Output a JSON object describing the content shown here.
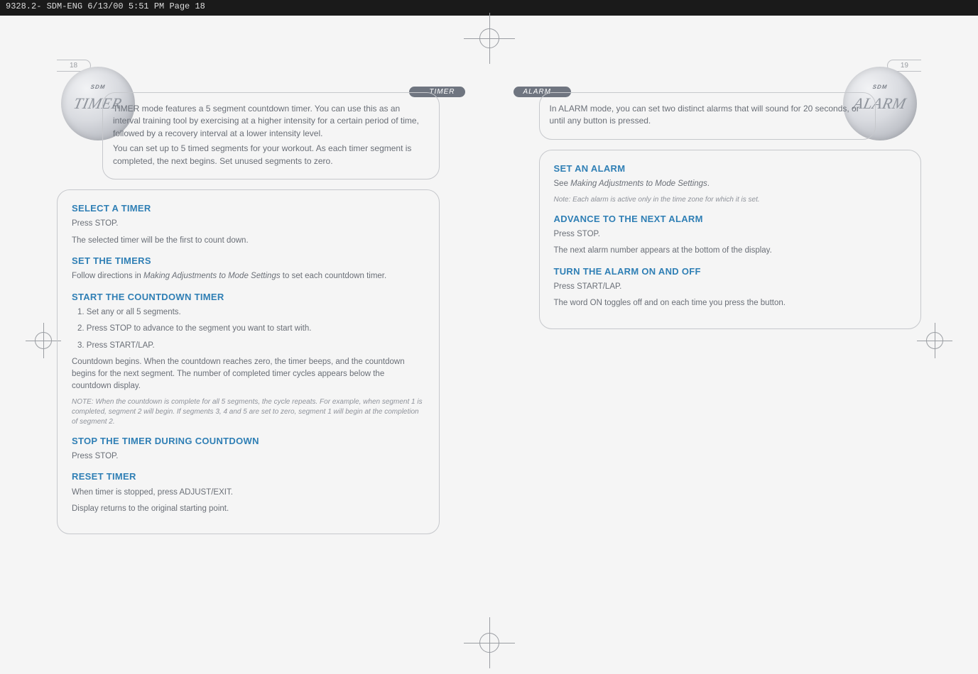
{
  "header": {
    "filename": "9328.2- SDM-ENG  6/13/00  5:51 PM  Page 18"
  },
  "left": {
    "page_number": "18",
    "mode_tab": "TIMER",
    "watch_label": "TIMER",
    "watch_brand": "SDM",
    "intro_p1": "TIMER mode features a 5 segment countdown timer. You can use this as an interval training tool by exercising at a higher intensity for a certain period of time, followed by a recovery interval at a lower intensity level.",
    "intro_p2": "You can set up to 5 timed segments for your workout. As each timer segment is completed, the next begins. Set unused segments to zero.",
    "sec1": {
      "title": "SELECT A TIMER",
      "p1": "Press STOP.",
      "p2": "The selected timer will be the first to count down."
    },
    "sec2": {
      "title": "SET THE TIMERS",
      "p1_a": "Follow directions in ",
      "p1_em": "Making Adjustments to Mode Settings",
      "p1_b": " to set each countdown timer."
    },
    "sec3": {
      "title": "START THE COUNTDOWN TIMER",
      "step1": "1. Set any or all 5 segments.",
      "step2": "2. Press STOP to advance to the segment you want to start with.",
      "step3": "3. Press START/LAP.",
      "p1": "Countdown begins. When the countdown reaches zero, the timer beeps, and the countdown begins for the next segment. The number of completed timer cycles appears below the countdown display.",
      "note": "NOTE: When the countdown is complete for all 5 segments, the cycle repeats. For example, when segment 1 is completed, segment 2 will begin. If segments 3, 4 and 5 are set to zero, segment 1 will begin at the completion of segment 2."
    },
    "sec4": {
      "title": "STOP THE TIMER DURING COUNTDOWN",
      "p1": "Press STOP."
    },
    "sec5": {
      "title": "RESET TIMER",
      "p1": "When timer is stopped, press ADJUST/EXIT.",
      "p2": "Display returns to the original starting point."
    }
  },
  "right": {
    "page_number": "19",
    "mode_tab": "ALARM",
    "watch_label": "ALARM",
    "watch_brand": "SDM",
    "intro_p1": "In ALARM mode, you can set two distinct alarms that will sound for 20 seconds, or until any button is pressed.",
    "sec1": {
      "title": "SET AN ALARM",
      "p1_a": "See ",
      "p1_em": "Making Adjustments to Mode Settings",
      "p1_b": ".",
      "note": "Note: Each alarm is active only in the time zone for which it is set."
    },
    "sec2": {
      "title": "ADVANCE TO THE NEXT ALARM",
      "p1": "Press STOP.",
      "p2": "The next alarm number appears at the bottom of the display."
    },
    "sec3": {
      "title": "TURN THE ALARM ON AND OFF",
      "p1": "Press START/LAP.",
      "p2": "The word ON toggles off and on each time you press the button."
    }
  }
}
